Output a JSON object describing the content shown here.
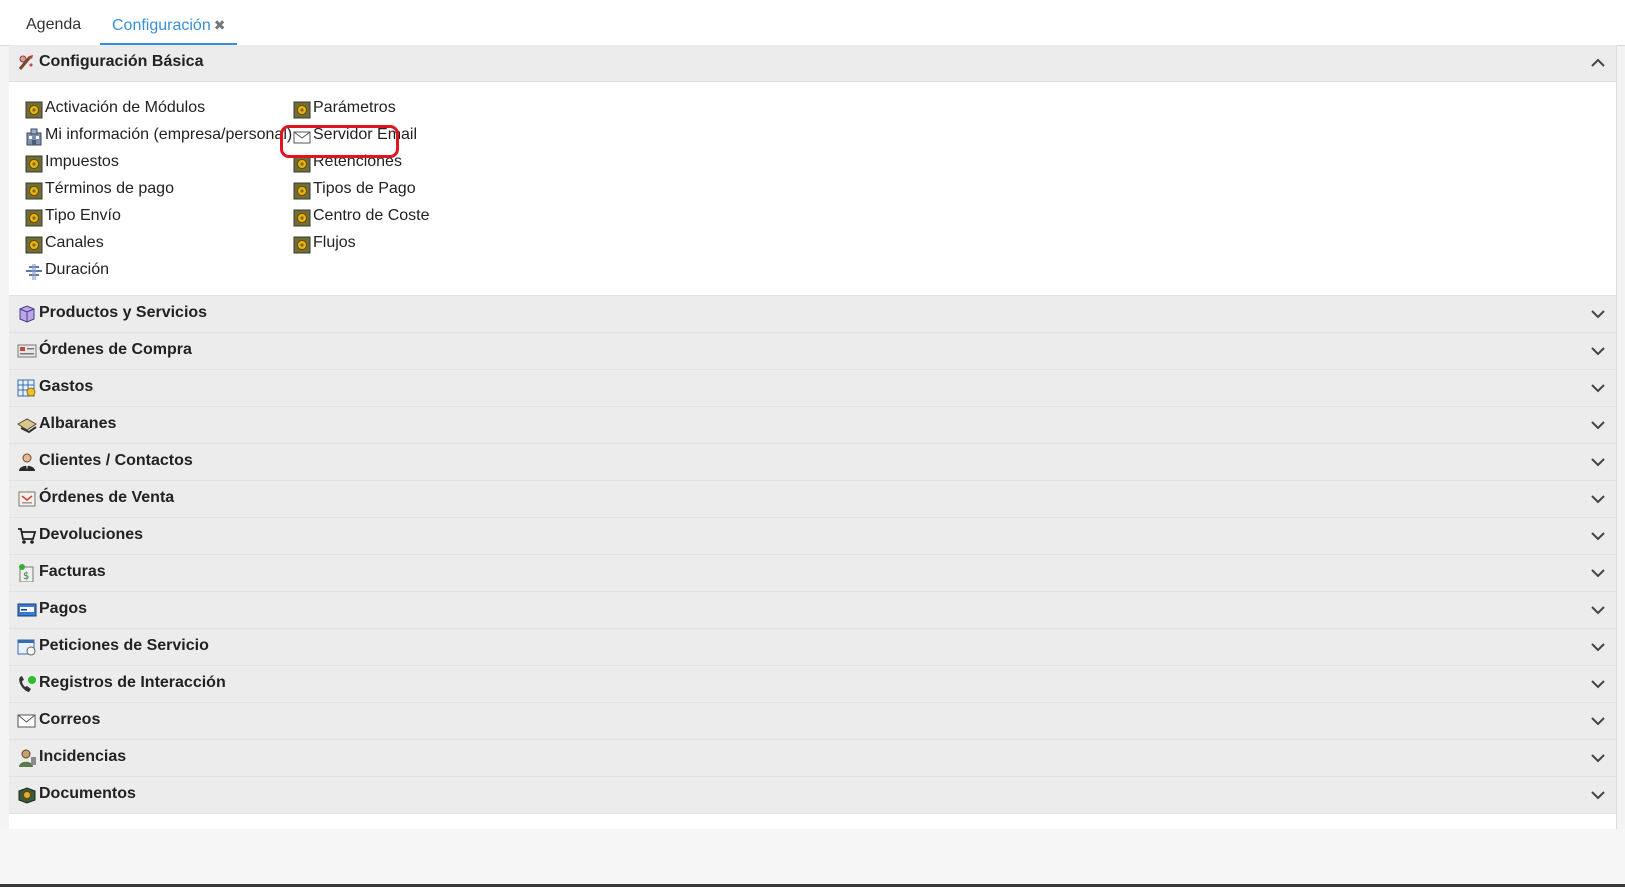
{
  "tabs": [
    {
      "label": "Agenda"
    },
    {
      "label": "Configuración",
      "close": "✖"
    }
  ],
  "accent_color": "#3a8fd8",
  "highlight_color": "#e0141e",
  "basic": {
    "title": "Configuración Básica",
    "icon": "settings-wand-icon",
    "left_items": [
      {
        "label": "Activación de Módulos",
        "icon": "gear-box-icon"
      },
      {
        "label": "Mi información (empresa/personal)",
        "icon": "company-building-icon"
      },
      {
        "label": "Impuestos",
        "icon": "gear-box-icon"
      },
      {
        "label": "Términos de pago",
        "icon": "gear-box-icon"
      },
      {
        "label": "Tipo Envío",
        "icon": "gear-box-icon"
      },
      {
        "label": "Canales",
        "icon": "gear-box-icon"
      },
      {
        "label": "Duración",
        "icon": "duration-icon"
      }
    ],
    "right_items": [
      {
        "label": "Parámetros",
        "icon": "gear-box-icon"
      },
      {
        "label": "Servidor Email",
        "icon": "envelope-icon"
      },
      {
        "label": "Retenciones",
        "icon": "gear-box-icon"
      },
      {
        "label": "Tipos de Pago",
        "icon": "gear-box-icon"
      },
      {
        "label": "Centro de Coste",
        "icon": "gear-box-icon"
      },
      {
        "label": "Flujos",
        "icon": "gear-box-icon"
      }
    ]
  },
  "sections": [
    {
      "title": "Productos y Servicios",
      "icon": "product-box-icon"
    },
    {
      "title": "Órdenes de Compra",
      "icon": "purchase-order-icon"
    },
    {
      "title": "Gastos",
      "icon": "expenses-icon"
    },
    {
      "title": "Albaranes",
      "icon": "delivery-note-icon"
    },
    {
      "title": "Clientes / Contactos",
      "icon": "contact-person-icon"
    },
    {
      "title": "Órdenes de Venta",
      "icon": "sales-order-icon"
    },
    {
      "title": "Devoluciones",
      "icon": "cart-return-icon"
    },
    {
      "title": "Facturas",
      "icon": "invoice-icon"
    },
    {
      "title": "Pagos",
      "icon": "credit-card-icon"
    },
    {
      "title": "Peticiones de Servicio",
      "icon": "service-request-icon"
    },
    {
      "title": "Registros de Interacción",
      "icon": "phone-interaction-icon"
    },
    {
      "title": "Correos",
      "icon": "envelope-icon"
    },
    {
      "title": "Incidencias",
      "icon": "incident-person-icon"
    },
    {
      "title": "Documentos",
      "icon": "documents-icon"
    }
  ]
}
